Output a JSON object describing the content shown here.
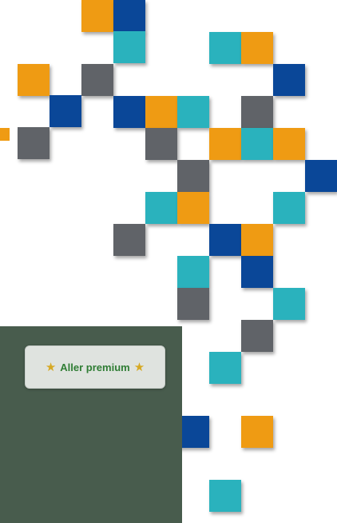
{
  "panel": {
    "premium_button": {
      "label": "Aller premium",
      "icon": "star-icon"
    }
  },
  "colors": {
    "orange": "#ef9b13",
    "teal": "#2ab2bd",
    "navy": "#0a4798",
    "gray": "#606368",
    "panel_background": "#485c4d",
    "button_background": "#dfe3df",
    "button_text": "#2f7d34",
    "star": "#d6a924"
  }
}
